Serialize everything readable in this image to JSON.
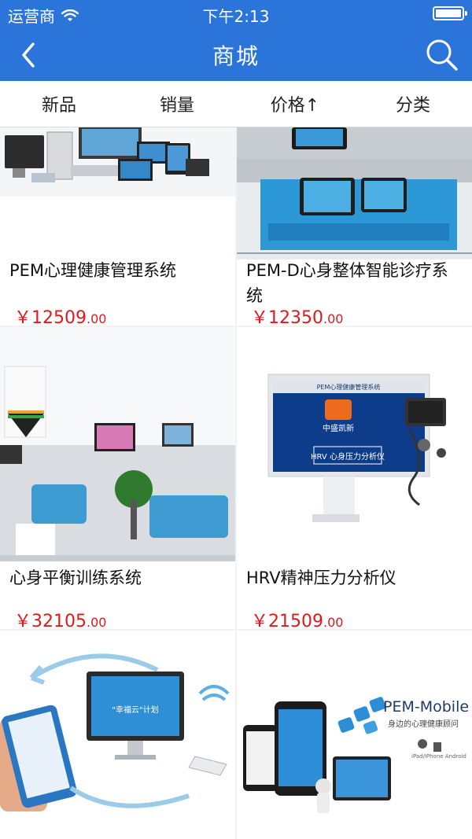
{
  "status_bar": {
    "carrier": "运营商",
    "time": "下午2:13"
  },
  "nav": {
    "title": "商城"
  },
  "filters": [
    {
      "label": "新品"
    },
    {
      "label": "销量"
    },
    {
      "label": "价格↑"
    },
    {
      "label": "分类"
    }
  ],
  "products": [
    {
      "name": "PEM心理健康管理系统",
      "currency": "￥",
      "price_int": "12509",
      "price_dec": ".00"
    },
    {
      "name": "PEM-D心身整体智能诊疗系统",
      "currency": "￥",
      "price_int": "12350",
      "price_dec": ".00"
    },
    {
      "name": "心身平衡训练系统",
      "currency": "￥",
      "price_int": "32105",
      "price_dec": ".00"
    },
    {
      "name": "HRV精神压力分析仪",
      "currency": "￥",
      "price_int": "21509",
      "price_dec": ".00"
    }
  ],
  "images": {
    "p4_caption": "PEM心理健康管理系统",
    "p4_logo": "中盛凯新",
    "p4_screen": "HRV 心身压力分析仪",
    "p5_screen": "\"幸福云\"计划",
    "p6_brand": "PEM-Mobile",
    "p6_tagline": "身边的心理健康顾问",
    "p6_small": "iPad/iPhone Android"
  }
}
